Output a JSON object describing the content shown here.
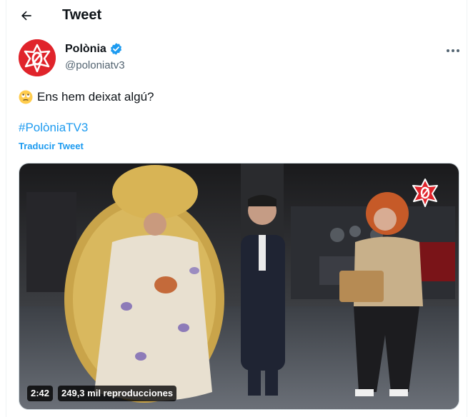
{
  "header": {
    "title": "Tweet",
    "back_icon": "arrow-left-icon"
  },
  "author": {
    "name": "Polònia",
    "handle": "@poloniatv3",
    "verified": true,
    "verified_color": "#1d9bf0",
    "avatar_color": "#e0242b"
  },
  "tweet": {
    "emoji": "face-with-rolling-eyes",
    "text": "Ens hem deixat algú?",
    "hashtag": "#PolòniaTV3",
    "translate_label": "Traducir Tweet"
  },
  "video": {
    "duration": "2:42",
    "views": "249,3 mil reproducciones"
  },
  "colors": {
    "link": "#1d9bf0",
    "secondary_text": "#536471"
  }
}
